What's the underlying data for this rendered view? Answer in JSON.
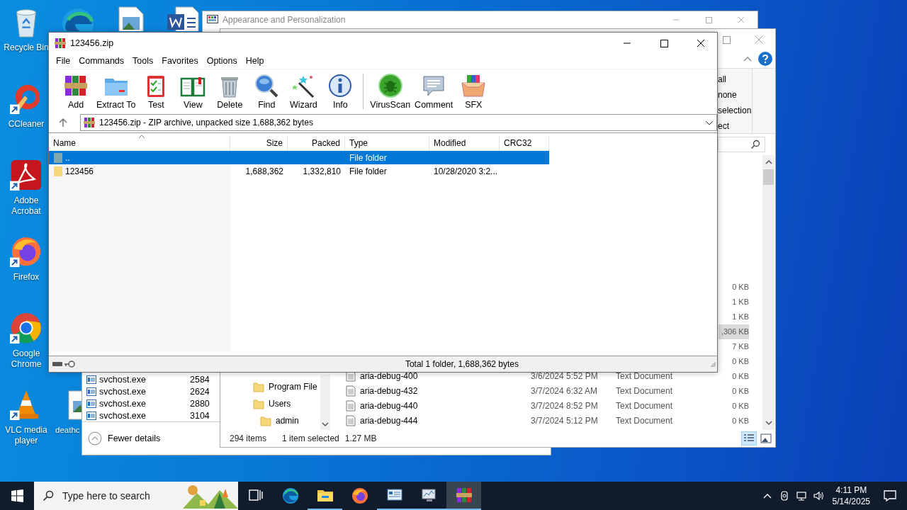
{
  "desktop_icons": [
    {
      "label": "Recycle Bin",
      "kind": "recycle",
      "shortcut": false
    },
    {
      "label": "CCleaner",
      "kind": "ccleaner",
      "shortcut": true
    },
    {
      "label": "Adobe Acrobat",
      "kind": "acrobat",
      "shortcut": true
    },
    {
      "label": "Firefox",
      "kind": "firefox",
      "shortcut": true
    },
    {
      "label": "Google Chrome",
      "kind": "chrome",
      "shortcut": true
    },
    {
      "label": "VLC media player",
      "kind": "vlc",
      "shortcut": true
    }
  ],
  "top_icons": [
    {
      "kind": "edge"
    },
    {
      "kind": "image"
    },
    {
      "kind": "word"
    }
  ],
  "desktop_file": {
    "label": "deathc",
    "kind": "image"
  },
  "back_window": {
    "title": "Appearance and Personalization"
  },
  "explorer": {
    "ribbon_items": [
      "all",
      "none",
      "selection",
      "ect"
    ],
    "files": [
      {
        "size": "0 KB",
        "selected": false
      },
      {
        "size": "1 KB",
        "selected": false
      },
      {
        "size": "1 KB",
        "selected": false
      },
      {
        "size": ",306 KB",
        "selected": true
      },
      {
        "size": "7 KB",
        "selected": false
      },
      {
        "size": "0 KB",
        "selected": false
      },
      {
        "name": "aria-debug-400",
        "date": "3/6/2024 5:52 PM",
        "type": "Text Document",
        "size": "0 KB",
        "selected": false
      },
      {
        "name": "aria-debug-432",
        "date": "3/7/2024 6:32 AM",
        "type": "Text Document",
        "size": "0 KB",
        "selected": false
      },
      {
        "name": "aria-debug-440",
        "date": "3/7/2024 8:52 PM",
        "type": "Text Document",
        "size": "0 KB",
        "selected": false
      },
      {
        "name": "aria-debug-444",
        "date": "3/7/2024 5:12 PM",
        "type": "Text Document",
        "size": "0 KB",
        "selected": false
      }
    ],
    "nav": [
      {
        "label": "Program File"
      },
      {
        "label": "Users",
        "children": [
          {
            "label": "admin"
          }
        ]
      }
    ],
    "status": {
      "items": "294 items",
      "selection": "1 item selected",
      "size": "1.27 MB"
    },
    "views": [
      {
        "kind": "details",
        "selected": true
      },
      {
        "kind": "thumbnails",
        "selected": false
      }
    ]
  },
  "task_manager": {
    "processes": [
      {
        "name": "svchost.exe",
        "pid": "2584"
      },
      {
        "name": "svchost.exe",
        "pid": "2624"
      },
      {
        "name": "svchost.exe",
        "pid": "2880"
      },
      {
        "name": "svchost.exe",
        "pid": "3104"
      }
    ],
    "footer": "Fewer details"
  },
  "winrar": {
    "title": "123456.zip",
    "menu": [
      "File",
      "Commands",
      "Tools",
      "Favorites",
      "Options",
      "Help"
    ],
    "toolbar": [
      {
        "label": "Add",
        "kind": "add"
      },
      {
        "label": "Extract To",
        "kind": "extract"
      },
      {
        "label": "Test",
        "kind": "test"
      },
      {
        "label": "View",
        "kind": "view"
      },
      {
        "label": "Delete",
        "kind": "delete"
      },
      {
        "label": "Find",
        "kind": "find"
      },
      {
        "label": "Wizard",
        "kind": "wizard"
      },
      {
        "label": "Info",
        "kind": "info"
      },
      {
        "kind": "separator"
      },
      {
        "label": "VirusScan",
        "kind": "virusscan"
      },
      {
        "label": "Comment",
        "kind": "comment"
      },
      {
        "label": "SFX",
        "kind": "sfx"
      }
    ],
    "address": "123456.zip - ZIP archive, unpacked size 1,688,362 bytes",
    "columns": [
      "Name",
      "Size",
      "Packed",
      "Type",
      "Modified",
      "CRC32"
    ],
    "rows": [
      {
        "name": "..",
        "type": "File folder",
        "kind": "up",
        "selected": true
      },
      {
        "name": "123456",
        "size": "1,688,362",
        "packed": "1,332,810",
        "type": "File folder",
        "modified": "10/28/2020 3:2...",
        "kind": "folder",
        "selected": false
      }
    ],
    "status": "Total 1 folder, 1,688,362 bytes"
  },
  "taskbar": {
    "search_placeholder": "Type here to search",
    "apps": [
      {
        "kind": "taskview",
        "running": false,
        "selected": false
      },
      {
        "kind": "edge",
        "running": false,
        "selected": false
      },
      {
        "kind": "explorer",
        "running": true,
        "selected": false
      },
      {
        "kind": "firefox",
        "running": false,
        "selected": false
      },
      {
        "kind": "control",
        "running": true,
        "selected": false
      },
      {
        "kind": "monitor",
        "running": true,
        "selected": false
      },
      {
        "kind": "winrar",
        "running": true,
        "selected": true
      }
    ],
    "time": "4:11 PM",
    "date": "5/14/2025"
  }
}
